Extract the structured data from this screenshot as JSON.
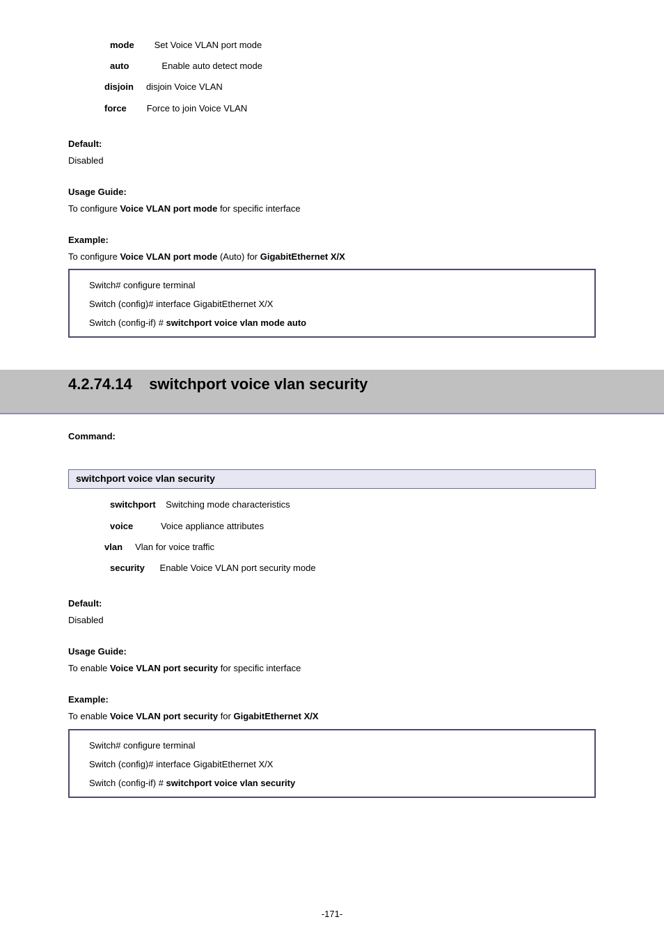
{
  "top_syntax": {
    "l1_bold": "mode",
    "l1_rest": "        Set Voice VLAN port mode",
    "l2_bold": "auto",
    "l2_rest": "             Enable auto detect mode",
    "l3_bold": "disjoin",
    "l3_rest": "     disjoin Voice VLAN",
    "l4_bold": "force",
    "l4_rest": "        Force to join Voice VLAN"
  },
  "default_label": "Default:",
  "default_value1": "Disabled",
  "usage_label": "Usage Guide:",
  "usage1_pre": "To configure ",
  "usage1_bold": "Voice VLAN port mode",
  "usage1_post": " for specific interface",
  "example_label": "Example:",
  "example1_pre": "To configure ",
  "example1_bold": "Voice VLAN port mode",
  "example1_mid": " (Auto) for ",
  "example1_bold2": "GigabitEthernet X/X",
  "code1": {
    "l1": "Switch# configure terminal",
    "l2": "Switch (config)# interface GigabitEthernet X/X",
    "l3_pre": "Switch (config-if) # ",
    "l3_bold": "switchport voice vlan mode auto"
  },
  "section_title": "4.2.74.14    switchport voice vlan security",
  "command_label": "Command:",
  "sub_header": "switchport voice vlan security",
  "syntax2": {
    "l1_bold": "switchport",
    "l1_rest": "    Switching mode characteristics",
    "l2_bold": "voice",
    "l2_rest": "           Voice appliance attributes",
    "l3_bold": "vlan",
    "l3_rest": "     Vlan for voice traffic",
    "l4_bold": "security",
    "l4_rest": "      Enable Voice VLAN port security mode"
  },
  "default_value2": "Disabled",
  "usage2_pre": "To enable ",
  "usage2_bold": "Voice VLAN port security",
  "usage2_post": " for specific interface",
  "example2_pre": "To enable ",
  "example2_bold": "Voice VLAN port security",
  "example2_mid": " for ",
  "example2_bold2": "GigabitEthernet X/X",
  "code2": {
    "l1": "Switch# configure terminal",
    "l2": "Switch (config)# interface GigabitEthernet X/X",
    "l3_pre": "Switch (config-if) # ",
    "l3_bold": "switchport voice vlan security"
  },
  "page_number": "-171-"
}
